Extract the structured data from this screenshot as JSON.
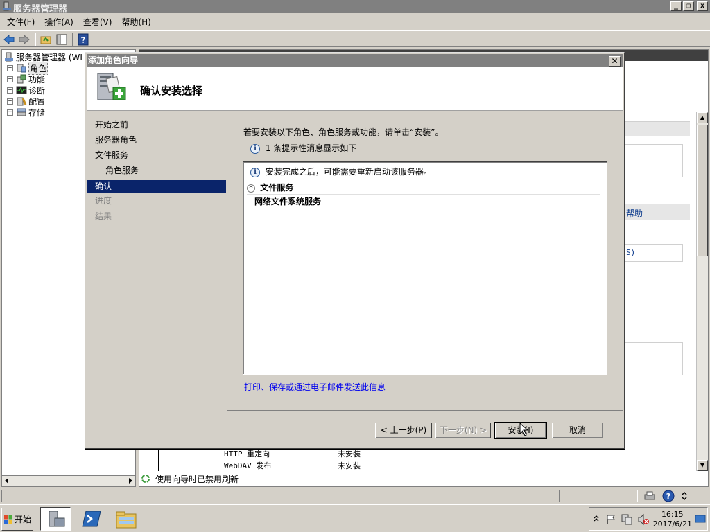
{
  "window": {
    "title": "服务器管理器"
  },
  "menu": [
    "文件(F)",
    "操作(A)",
    "查看(V)",
    "帮助(H)"
  ],
  "tree": {
    "root": "服务器管理器 (WI",
    "items": [
      "角色",
      "功能",
      "诊断",
      "配置",
      "存储"
    ]
  },
  "right_pane": {
    "help_fragment": "帮助",
    "s_fragment": "S)",
    "table_rows": [
      {
        "name": "HTTP 重定向",
        "status": "未安装"
      },
      {
        "name": "WebDAV 发布",
        "status": "未安装"
      }
    ],
    "refresh_note": "使用向导时已禁用刷新"
  },
  "dialog": {
    "title": "添加角色向导",
    "close_glyph": "✕",
    "header_title": "确认安装选择",
    "nav": [
      {
        "label": "开始之前",
        "state": "normal"
      },
      {
        "label": "服务器角色",
        "state": "normal"
      },
      {
        "label": "文件服务",
        "state": "normal"
      },
      {
        "label": "角色服务",
        "state": "normal"
      },
      {
        "label": "确认",
        "state": "active"
      },
      {
        "label": "进度",
        "state": "disabled"
      },
      {
        "label": "结果",
        "state": "disabled"
      }
    ],
    "intro": "若要安装以下角色、角色服务或功能，请单击“安装”。",
    "info_count": "1 条提示性消息显示如下",
    "info_message": "安装完成之后，可能需要重新启动该服务器。",
    "group_label": "文件服务",
    "group_item": "网络文件系统服务",
    "print_link": "打印、保存或通过电子邮件发送此信息",
    "buttons": {
      "back": "< 上一步(P)",
      "next": "下一步(N) >",
      "install": "安装(I)",
      "cancel": "取消"
    }
  },
  "taskbar": {
    "start": "开始",
    "time": "16:15",
    "date": "2017/6/21"
  },
  "colors": {
    "selection": "#0a246a",
    "titlebar": "#808080",
    "link": "#0000ee"
  }
}
